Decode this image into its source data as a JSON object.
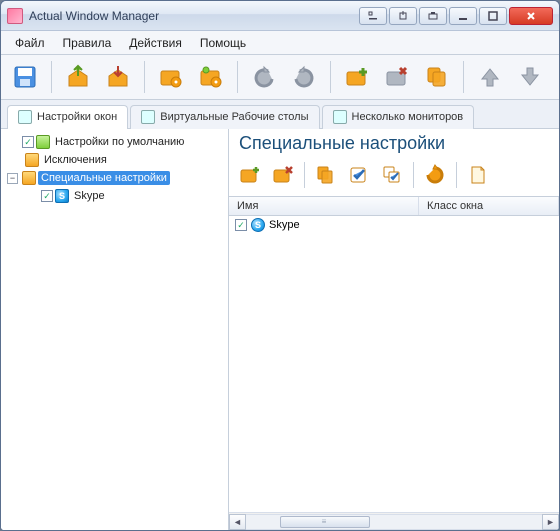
{
  "title": "Actual Window Manager",
  "menu": {
    "file": "Файл",
    "rules": "Правила",
    "actions": "Действия",
    "help": "Помощь"
  },
  "tabs": {
    "windows": "Настройки окон",
    "virtual": "Виртуальные Рабочие столы",
    "monitors": "Несколько мониторов"
  },
  "tree": {
    "defaults": "Настройки по умолчанию",
    "exclusions": "Исключения",
    "special": "Специальные настройки",
    "skype": "Skype"
  },
  "pane": {
    "title": "Специальные настройки",
    "columns": {
      "name": "Имя",
      "class": "Класс окна"
    },
    "rows": [
      {
        "name": "Skype",
        "class": "",
        "checked": true
      }
    ]
  },
  "icons": {
    "save": "save-icon",
    "open1": "box-out-icon",
    "open2": "box-in-icon",
    "gear1": "folder-gear1-icon",
    "gear2": "folder-gear2-icon",
    "undo": "undo-icon",
    "redo": "redo-icon",
    "foldadd": "folder-add-icon",
    "folddel": "folder-delete-icon",
    "copy": "copy-icon",
    "up": "arrow-up-icon",
    "down": "arrow-down-icon",
    "padd": "new-rule-icon",
    "pdel": "delete-rule-icon",
    "pcopy": "copy-rule-icon",
    "pcheck": "check-rule-icon",
    "pmulti": "multi-rule-icon",
    "prefresh": "refresh-icon",
    "ppage": "page-icon"
  }
}
